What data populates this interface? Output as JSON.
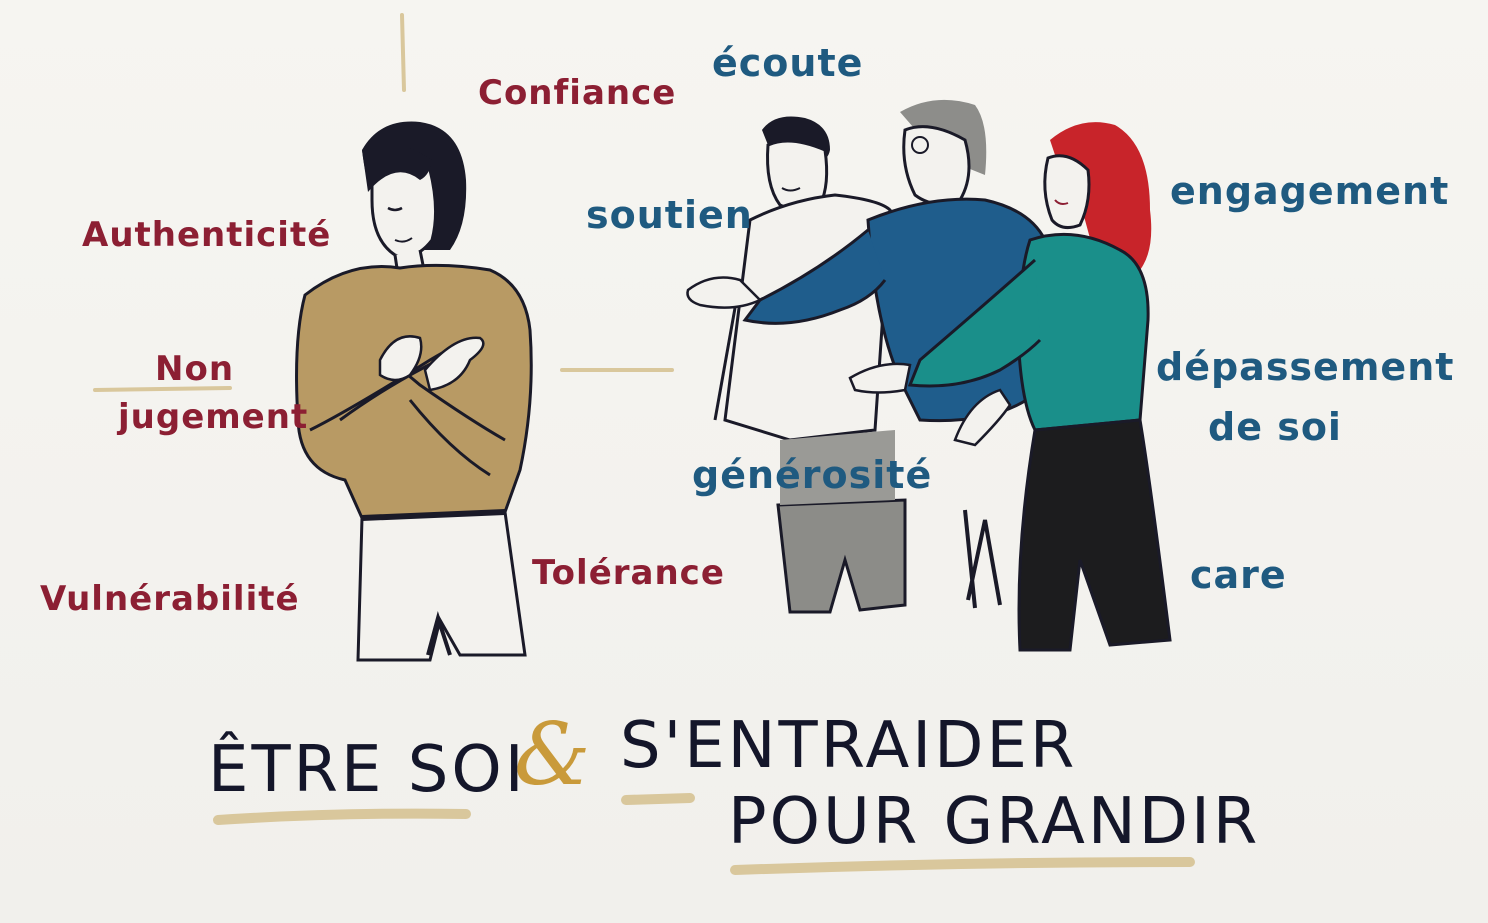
{
  "words": {
    "confiance": "Confiance",
    "ecoute": "écoute",
    "authenticite": "Authenticité",
    "soutien": "soutien",
    "engagement": "engagement",
    "non": "Non",
    "jugement": "jugement",
    "depassement": "dépassement",
    "de_soi": "de soi",
    "generosite": "générosité",
    "vulnerabilite": "Vulnérabilité",
    "tolerance": "Tolérance",
    "care": "care"
  },
  "title": {
    "etre_soi": "ÊTRE SOI",
    "amp": "&",
    "sentraider": "S'ENTRAIDER",
    "pour_grandir": "POUR GRANDIR"
  },
  "colors": {
    "red_words": "#8c1f33",
    "blue_words": "#1f5a80",
    "ochre": "#c99a3a",
    "ink": "#14162a"
  }
}
